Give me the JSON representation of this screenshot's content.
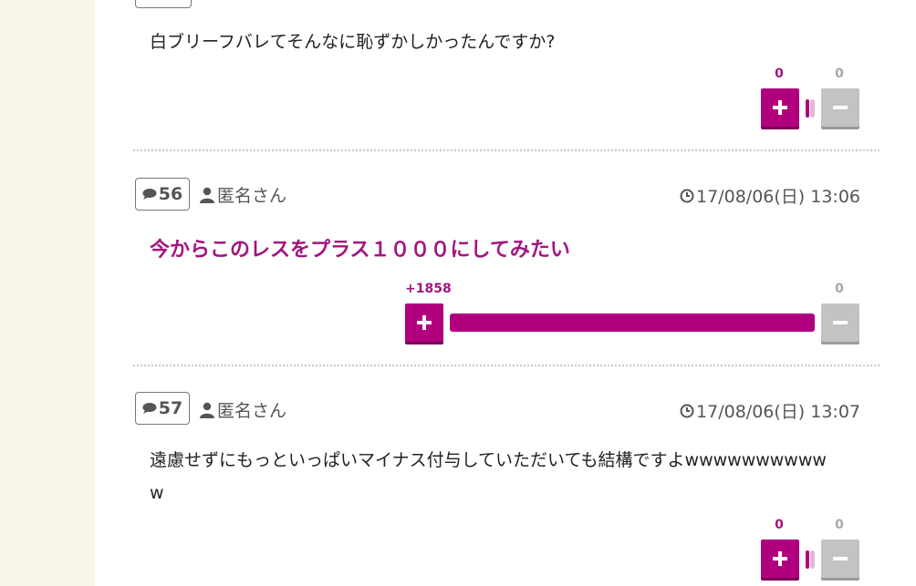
{
  "posts": [
    {
      "text": "白ブリーフバレてそんなに恥ずかしかったんですか?",
      "plus_count": "0",
      "minus_count": "0",
      "plus_share": 0,
      "minus_share": 0
    },
    {
      "number": "56",
      "author": "匿名さん",
      "date": "17/08/06(日) 13:06",
      "text": "今からこのレスをプラス１０００にしてみたい",
      "plus_count": "+1858",
      "minus_count": "0",
      "plus_share": 1.0,
      "minus_share": 0
    },
    {
      "number": "57",
      "author": "匿名さん",
      "date": "17/08/06(日) 13:07",
      "text_line1": "遠慮せずにもっといっぱいマイナス付与していただいても結構ですよwwwwwwwwww",
      "text_line2": "w",
      "plus_count": "0",
      "minus_count": "0",
      "plus_share": 0,
      "minus_share": 0
    }
  ],
  "colors": {
    "accent": "#b1007e",
    "neutral": "#c3c3c3",
    "sidebar_bg": "#f9f5e8"
  },
  "icons": {
    "comment": "speech-bubble-icon",
    "user": "person-icon",
    "clock": "clock-icon",
    "plus": "plus-icon",
    "minus": "minus-icon"
  }
}
